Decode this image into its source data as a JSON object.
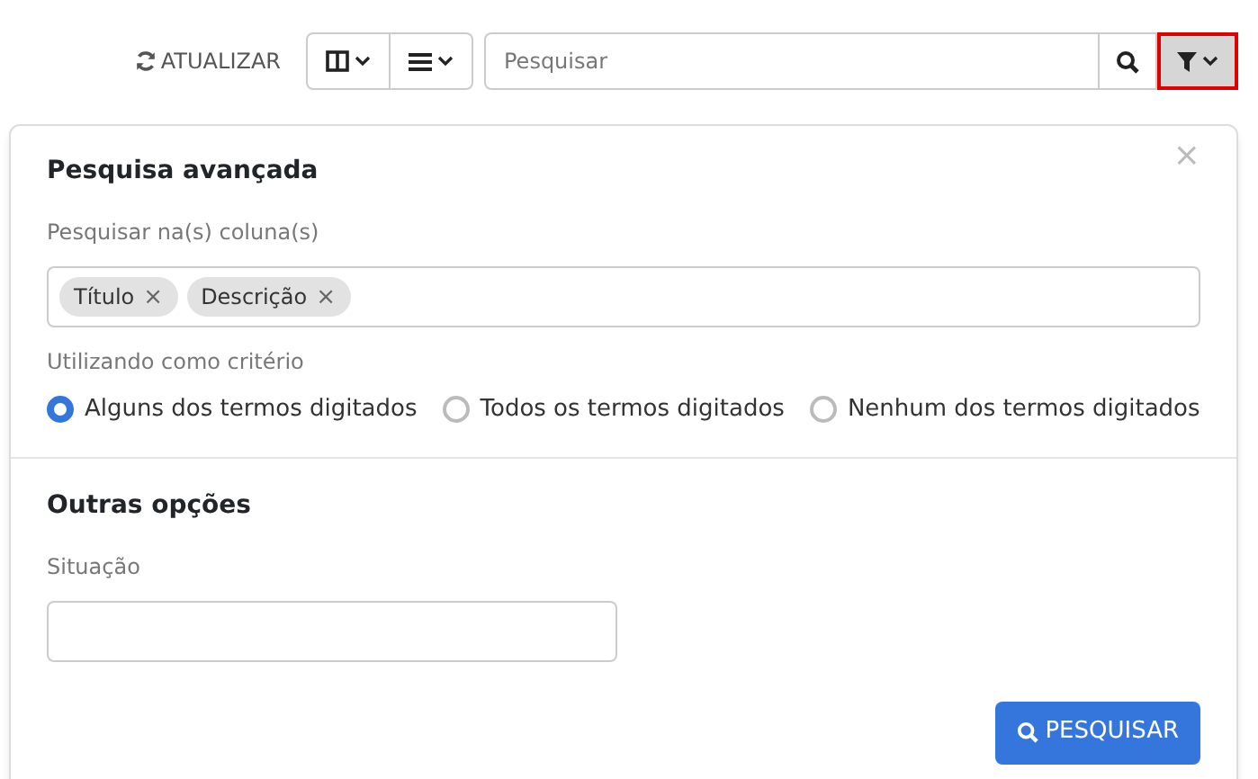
{
  "toolbar": {
    "refresh_label": "ATUALIZAR",
    "search": {
      "placeholder": "Pesquisar"
    },
    "filter_active": true
  },
  "panel": {
    "title": "Pesquisa avançada",
    "columns_label": "Pesquisar na(s) coluna(s)",
    "column_tags": [
      {
        "label": "Título",
        "remove": "×"
      },
      {
        "label": "Descrição",
        "remove": "×"
      }
    ],
    "criteria_label": "Utilizando como critério",
    "criteria": [
      {
        "label": "Alguns dos termos digitados",
        "selected": true
      },
      {
        "label": "Todos os termos digitados",
        "selected": false
      },
      {
        "label": "Nenhum dos termos digitados",
        "selected": false
      }
    ],
    "close": "×",
    "other_title": "Outras opções",
    "status_label": "Situação",
    "submit_label": "PESQUISAR"
  }
}
